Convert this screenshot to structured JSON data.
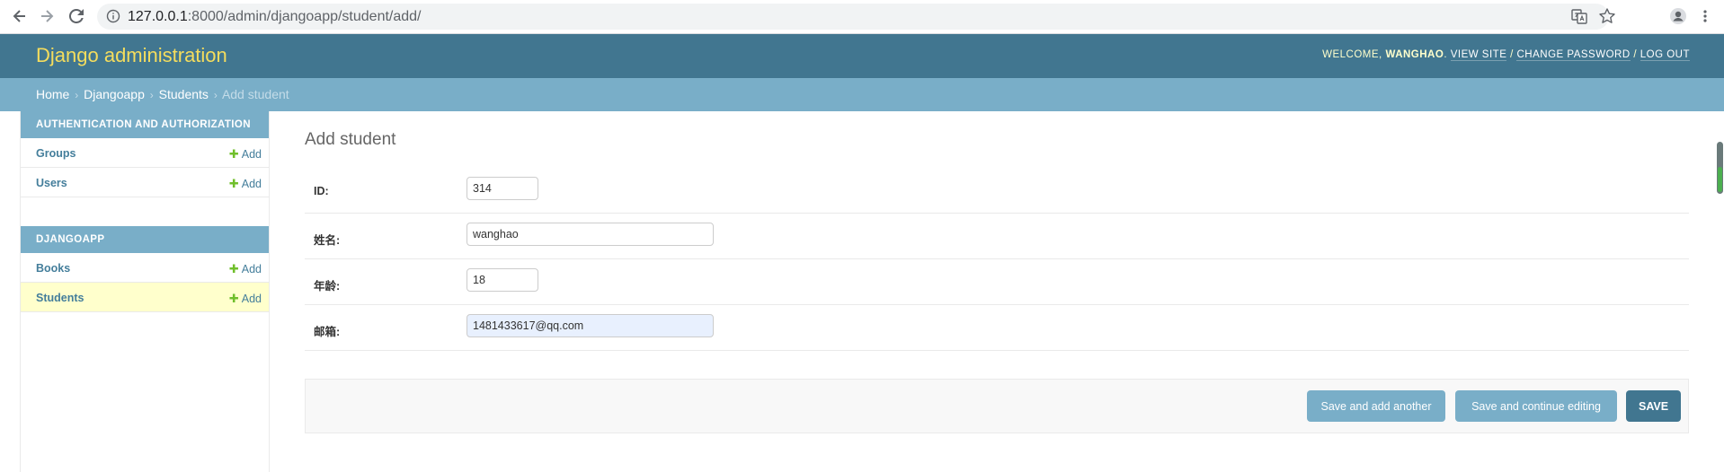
{
  "browser": {
    "url_host": "127.0.0.1",
    "url_path": ":8000/admin/djangoapp/student/add/",
    "icons": [
      "back-arrow-icon",
      "forward-arrow-icon",
      "reload-icon",
      "info-icon",
      "translate-icon",
      "star-icon",
      "profile-icon",
      "kebab-menu-icon"
    ]
  },
  "header": {
    "branding": "Django administration",
    "welcome": "WELCOME,",
    "username": "WANGHAO",
    "after_username": ".",
    "view_site": "VIEW SITE",
    "change_password": "CHANGE PASSWORD",
    "log_out": "LOG OUT",
    "separator": "/"
  },
  "breadcrumbs": {
    "home": "Home",
    "app": "Djangoapp",
    "model": "Students",
    "current": "Add student",
    "separator": "›"
  },
  "sidebar": {
    "modules": [
      {
        "caption": "AUTHENTICATION AND AUTHORIZATION",
        "rows": [
          {
            "name": "Groups",
            "add": "Add"
          },
          {
            "name": "Users",
            "add": "Add"
          }
        ]
      },
      {
        "caption": "DJANGOAPP",
        "rows": [
          {
            "name": "Books",
            "add": "Add"
          },
          {
            "name": "Students",
            "add": "Add"
          }
        ]
      }
    ]
  },
  "content": {
    "title": "Add student",
    "fields": [
      {
        "label": "ID:",
        "value": "314"
      },
      {
        "label": "姓名:",
        "value": "wanghao"
      },
      {
        "label": "年龄:",
        "value": "18"
      },
      {
        "label": "邮箱:",
        "value": "1481433617@qq.com"
      }
    ],
    "buttons": {
      "save_and_add_another": "Save and add another",
      "save_and_continue": "Save and continue editing",
      "save": "SAVE"
    }
  },
  "colors": {
    "header_bg": "#417690",
    "breadcrumbs_bg": "#79aec8",
    "branding": "#f5dd5d",
    "link": "#447e9b",
    "add_plus": "#70bf2b",
    "selected_row": "#ffffcc"
  }
}
